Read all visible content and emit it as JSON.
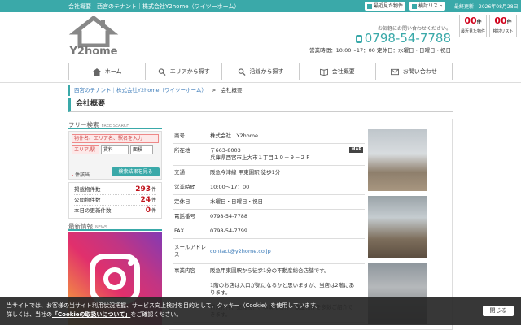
{
  "topbar": {
    "title": "会社概要｜西宮のテナント｜株式会社Y2home（ワイツーホーム）",
    "recent_button": "最近見た物件",
    "consider_button": "検討リスト",
    "updated": "最終更新：2026年08月28日"
  },
  "counters": [
    {
      "number": "00",
      "unit": "件",
      "label": "最近見た物件"
    },
    {
      "number": "00",
      "unit": "件",
      "label": "検討リスト"
    }
  ],
  "logo": {
    "text": "Y2home"
  },
  "header_info": {
    "prompt": "お気軽にお問い合わせください。",
    "tel": "0798-54-7788",
    "hours": "営業時間：10:00〜17：00 定休日：水曜日・日曜日・祝日"
  },
  "nav": [
    {
      "label": "ホーム",
      "icon": "home-icon"
    },
    {
      "label": "エリアから探す",
      "icon": "search-icon"
    },
    {
      "label": "沿線から探す",
      "icon": "search-icon"
    },
    {
      "label": "会社概要",
      "icon": "book-icon"
    },
    {
      "label": "お問い合わせ",
      "icon": "mail-icon"
    }
  ],
  "breadcrumb": {
    "home": "西宮のテナント｜株式会社Y2home（ワイツーホーム）",
    "sep": ">",
    "current": "会社概要"
  },
  "page_title": "会社概要",
  "sidebar": {
    "search_title": "フリー検索",
    "search_sub": "FREE SEARCH",
    "keyword_placeholder": "物件名、エリア名、駅名を入力",
    "area_select": "エリア,駅",
    "rent_select": "賃料",
    "size_select": "面積",
    "checkbox_label": "件該当",
    "search_button": "検索結果を見る",
    "stats": [
      {
        "label": "掲載物件数",
        "value": "293",
        "unit": "件"
      },
      {
        "label": "公開物件数",
        "value": "24",
        "unit": "件"
      },
      {
        "label": "本日の更新件数",
        "value": "0",
        "unit": "件"
      }
    ],
    "news_title": "最新情報",
    "news_sub": "NEWS"
  },
  "company": {
    "rows": [
      {
        "key": "商号",
        "value": "株式会社　Y2home"
      },
      {
        "key": "所在地",
        "value": "〒663-8003\n兵庫県西宮市上大市１丁目１０－９－２Ｆ",
        "badge": "MAP"
      },
      {
        "key": "交通",
        "value": "阪急今津線 甲東園駅 徒歩1分"
      },
      {
        "key": "営業時間",
        "value": "10:00〜17：00"
      },
      {
        "key": "定休日",
        "value": "水曜日・日曜日・祝日"
      },
      {
        "key": "電話番号",
        "value": "0798-54-7788"
      },
      {
        "key": "FAX",
        "value": "0798-54-7799"
      },
      {
        "key": "メールアドレス",
        "value": "contact@y2home.co.jp",
        "link": true
      },
      {
        "key": "事業内容",
        "value": "阪急甲東園駅から徒歩1分の不動産総合店舗です。\n\n1階のお店は入口が気になるかと思いますが、当店は2階にあ\nります。\n\n賃貸物件、売買物件、事業用物件、収益物件を多数ご紹介で\nきます。"
      }
    ]
  },
  "cookie": {
    "line1": "当サイトでは、お客様の当サイト利用状況把握、サービス向上検討を目的として、クッキー（Cookie）を使用しています。",
    "line2_pre": "詳しくは、当社の",
    "line2_link": "「Cookieの取扱いについて」",
    "line2_post": "をご確認ください。",
    "close_button": "閉じる"
  },
  "colors": {
    "accent": "#3aa9a9",
    "count": "#c0131b",
    "link": "#3a7ab8"
  }
}
